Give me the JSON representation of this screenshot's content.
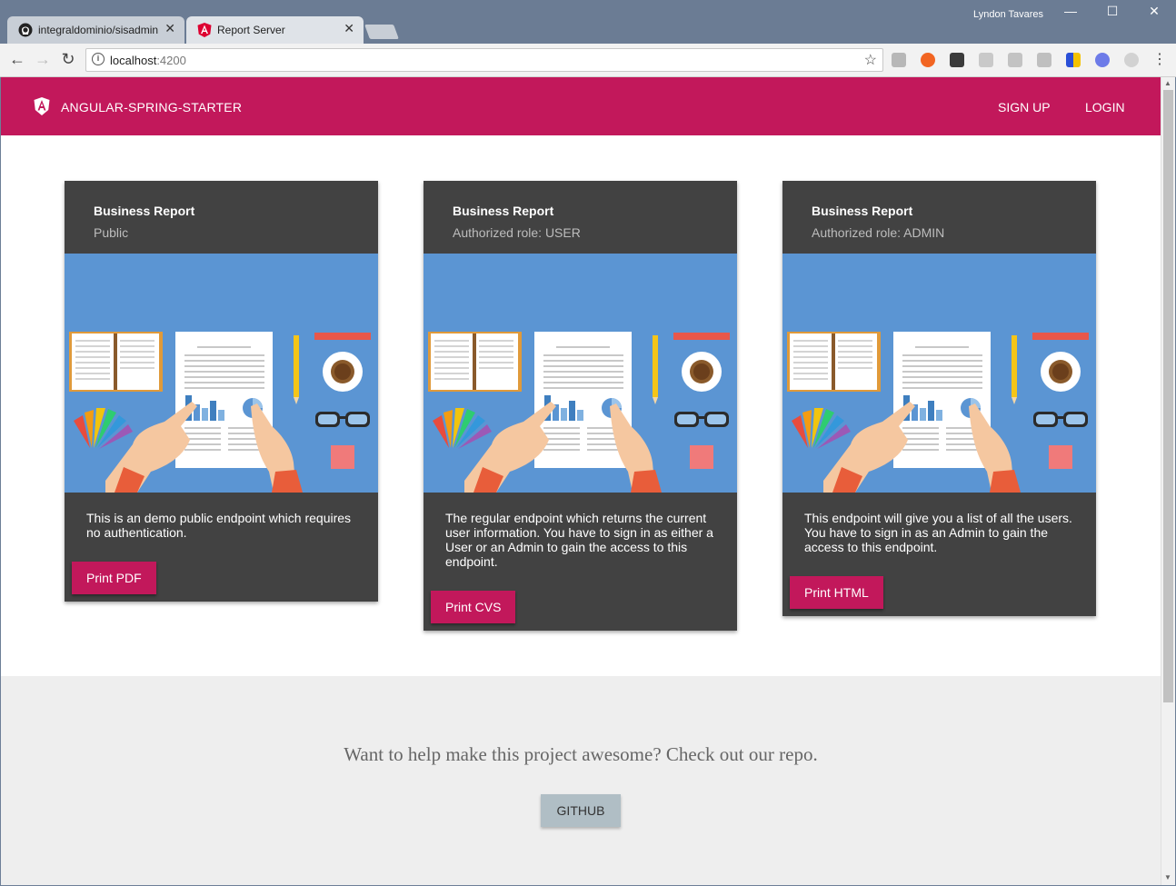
{
  "browser": {
    "tabs": [
      {
        "title": "integraldominio/sisadmin",
        "active": false,
        "icon": "github-icon"
      },
      {
        "title": "Report Server",
        "active": true,
        "icon": "angular-icon"
      }
    ],
    "user_name": "Lyndon Tavares",
    "url_host": "localhost",
    "url_port": ":4200",
    "close_glyph": "✕",
    "minimize_glyph": "—",
    "maximize_glyph": "☐"
  },
  "app": {
    "title": "ANGULAR-SPRING-STARTER",
    "brand_color": "#c2185b",
    "nav": {
      "signup": "SIGN UP",
      "login": "LOGIN"
    }
  },
  "cards": [
    {
      "title": "Business Report",
      "subtitle": "Public",
      "body": "This is an demo public endpoint which requires no authentication.",
      "button": "Print PDF"
    },
    {
      "title": "Business Report",
      "subtitle": "Authorized role: USER",
      "body": "The regular endpoint which returns the current user information. You have to sign in as either a User or an Admin to gain the access to this endpoint.",
      "button": "Print CVS"
    },
    {
      "title": "Business Report",
      "subtitle": "Authorized role: ADMIN",
      "body": "This endpoint will give you a list of all the users. You have to sign in as an Admin to gain the access to this endpoint.",
      "button": "Print HTML"
    }
  ],
  "footer": {
    "text": "Want to help make this project awesome? Check out our repo.",
    "button": "GITHUB"
  }
}
